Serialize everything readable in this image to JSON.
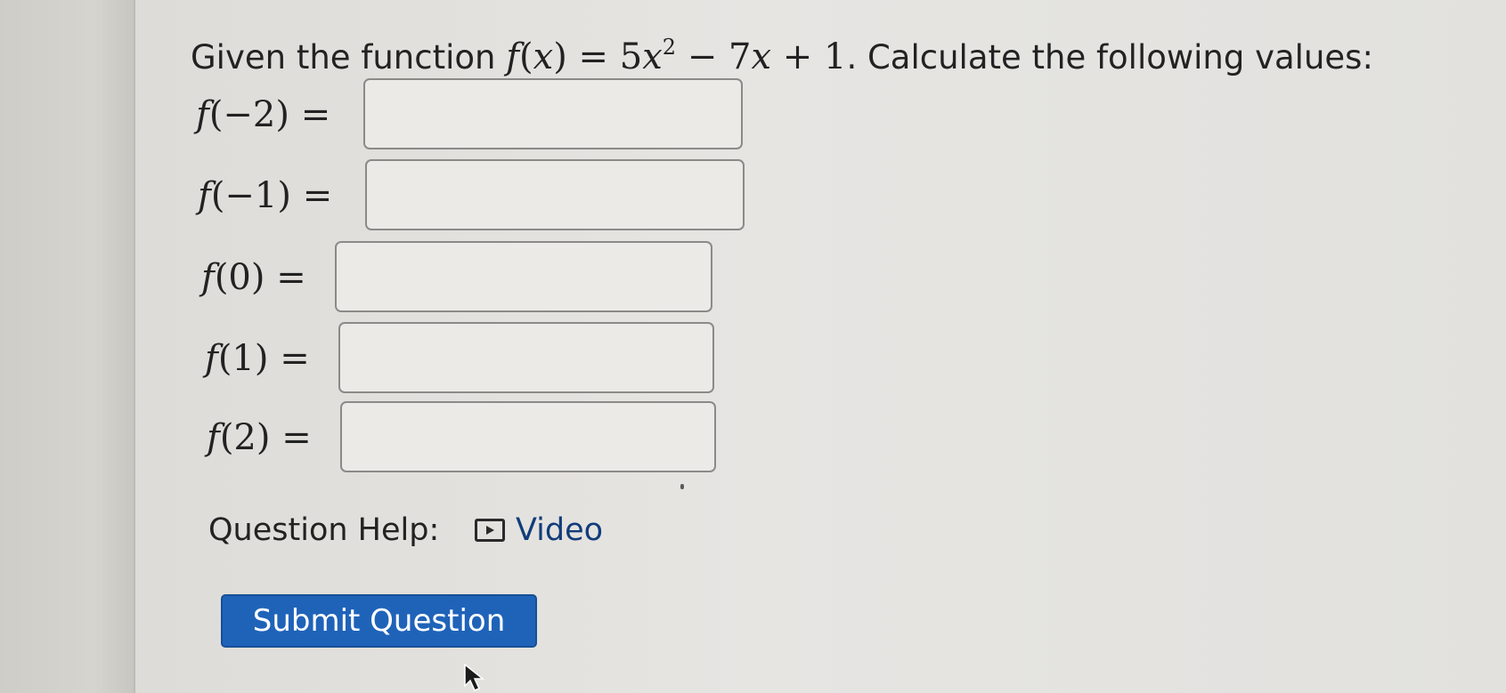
{
  "question": {
    "intro": "Given the function",
    "func_name": "f",
    "func_var": "x",
    "eq": "=",
    "coef_a": "5",
    "exp": "2",
    "rest": "− 7",
    "rest_var": "x",
    "rest_tail": "+ 1",
    "outro": ". Calculate the following values:"
  },
  "rows": [
    {
      "fn": "f",
      "arg": "(−2) =",
      "value": ""
    },
    {
      "fn": "f",
      "arg": "(−1) =",
      "value": ""
    },
    {
      "fn": "f",
      "arg": "(0) =",
      "value": ""
    },
    {
      "fn": "f",
      "arg": "(1) =",
      "value": ""
    },
    {
      "fn": "f",
      "arg": "(2) =",
      "value": ""
    }
  ],
  "help": {
    "label": "Question Help:",
    "video_label": "Video",
    "video_icon": "play-video-icon"
  },
  "submit": {
    "label": "Submit Question",
    "color": "#1f63b9"
  },
  "cursor_icon": "mouse-pointer-icon"
}
